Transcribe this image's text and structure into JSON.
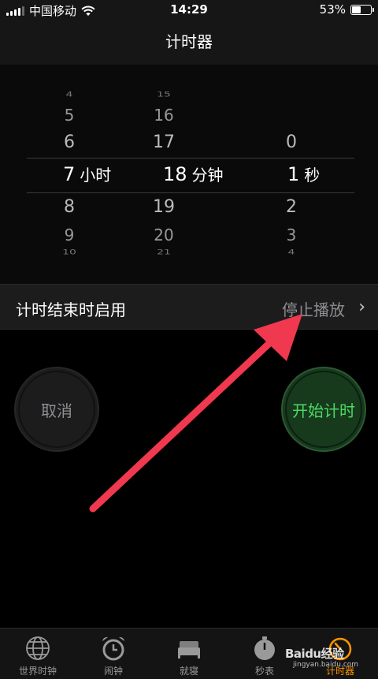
{
  "status_bar": {
    "carrier": "中国移动",
    "time": "14:29",
    "battery_percent_label": "53%",
    "battery_level": 0.53,
    "icons": [
      "signal-icon",
      "wifi-icon",
      "battery-icon"
    ]
  },
  "nav": {
    "title": "计时器"
  },
  "picker": {
    "hours": {
      "above": [
        "4",
        "5",
        "6"
      ],
      "selected": "7",
      "unit": "小时",
      "below": [
        "8",
        "9",
        "10"
      ]
    },
    "minutes": {
      "above": [
        "15",
        "16",
        "17"
      ],
      "selected": "18",
      "unit": "分钟",
      "below": [
        "19",
        "20",
        "21"
      ]
    },
    "seconds": {
      "above": [
        "0"
      ],
      "selected": "1",
      "unit": "秒",
      "below": [
        "2",
        "3",
        "4"
      ]
    }
  },
  "when_timer_ends": {
    "label": "计时结束时启用",
    "value": "停止播放"
  },
  "buttons": {
    "cancel": "取消",
    "start": "开始计时"
  },
  "tabs": [
    {
      "label": "世界时钟",
      "icon": "globe-icon"
    },
    {
      "label": "闹钟",
      "icon": "alarm-clock-icon"
    },
    {
      "label": "就寝",
      "icon": "bed-icon"
    },
    {
      "label": "秒表",
      "icon": "stopwatch-icon"
    },
    {
      "label": "计时器",
      "icon": "timer-icon",
      "active": true
    }
  ],
  "watermark": {
    "brand": "Baidu经验",
    "url": "jingyan.baidu.com"
  },
  "colors": {
    "accent": "#ff9500",
    "start_green": "#4cd964",
    "annotation_arrow": "#f0384f"
  }
}
